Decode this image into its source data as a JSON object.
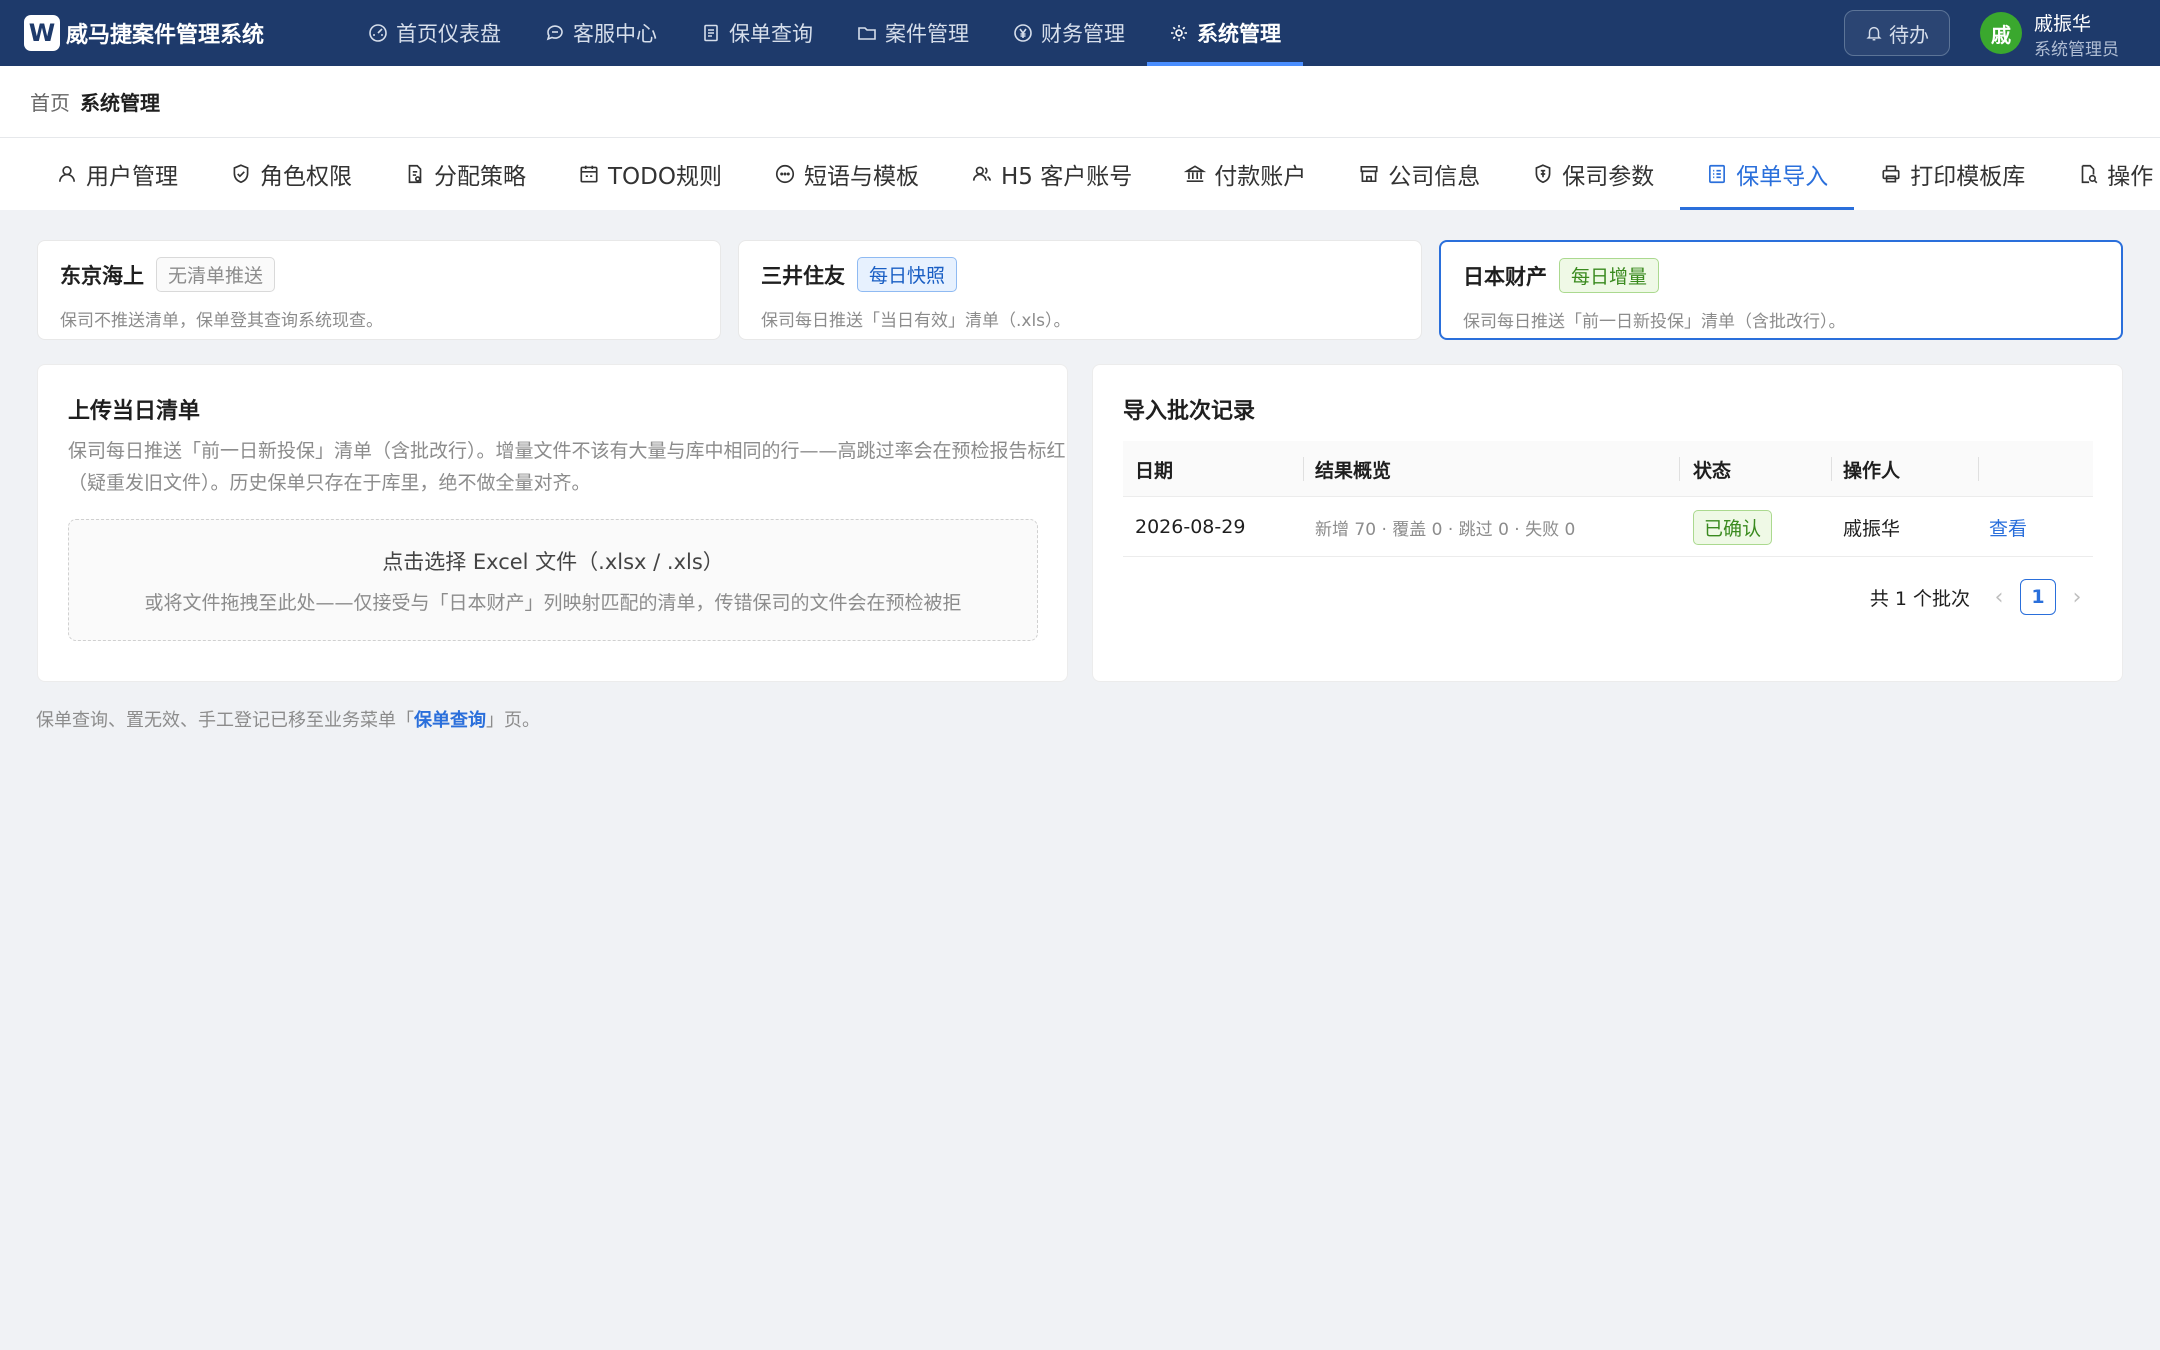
{
  "app": {
    "logo_letter": "W",
    "title": "威马捷案件管理系统"
  },
  "nav": {
    "items": [
      {
        "label": "首页仪表盘",
        "icon": "dashboard-icon"
      },
      {
        "label": "客服中心",
        "icon": "chat-icon"
      },
      {
        "label": "保单查询",
        "icon": "document-icon"
      },
      {
        "label": "案件管理",
        "icon": "folder-icon"
      },
      {
        "label": "财务管理",
        "icon": "yen-icon"
      },
      {
        "label": "系统管理",
        "icon": "gear-icon"
      }
    ],
    "active_index": 5
  },
  "header": {
    "todo_label": "待办",
    "user": {
      "avatar_text": "戚",
      "name": "戚振华",
      "role": "系统管理员",
      "avatar_color": "#3aa82e"
    }
  },
  "breadcrumb": {
    "home": "首页",
    "current": "系统管理"
  },
  "tabs": {
    "items": [
      {
        "label": "用户管理",
        "icon": "user-icon"
      },
      {
        "label": "角色权限",
        "icon": "shield-check-icon"
      },
      {
        "label": "分配策略",
        "icon": "doc-gear-icon"
      },
      {
        "label": "TODO规则",
        "icon": "calendar-icon"
      },
      {
        "label": "短语与模板",
        "icon": "message-icon"
      },
      {
        "label": "H5 客户账号",
        "icon": "users-icon"
      },
      {
        "label": "付款账户",
        "icon": "bank-icon"
      },
      {
        "label": "公司信息",
        "icon": "shop-icon"
      },
      {
        "label": "保司参数",
        "icon": "shield-param-icon"
      },
      {
        "label": "保单导入",
        "icon": "list-icon"
      },
      {
        "label": "打印模板库",
        "icon": "printer-icon"
      },
      {
        "label": "操作",
        "icon": "audit-icon"
      }
    ],
    "active_index": 9
  },
  "insurers": [
    {
      "name": "东京海上",
      "tag": "无清单推送",
      "tag_style": "gray",
      "desc": "保司不推送清单，保单登其查询系统现查。",
      "selected": false
    },
    {
      "name": "三井住友",
      "tag": "每日快照",
      "tag_style": "blue",
      "desc": "保司每日推送「当日有效」清单（.xls）。",
      "selected": false
    },
    {
      "name": "日本财产",
      "tag": "每日增量",
      "tag_style": "green",
      "desc": "保司每日推送「前一日新投保」清单（含批改行）。",
      "selected": true
    }
  ],
  "upload": {
    "title": "上传当日清单",
    "desc": "保司每日推送「前一日新投保」清单（含批改行）。增量文件不该有大量与库中相同的行——高跳过率会在预检报告标红（疑重发旧文件）。历史保单只存在于库里，绝不做全量对齐。",
    "dropzone_main": "点击选择 Excel 文件（.xlsx / .xls）",
    "dropzone_sub": "或将文件拖拽至此处——仅接受与「日本财产」列映射匹配的清单，传错保司的文件会在预检被拒"
  },
  "batches": {
    "title": "导入批次记录",
    "columns": [
      "日期",
      "结果概览",
      "状态",
      "操作人",
      ""
    ],
    "rows": [
      {
        "date": "2026-08-29",
        "summary": "新增 70 · 覆盖 0 · 跳过 0 · 失败 0",
        "status": "已确认",
        "operator": "戚振华",
        "action": "查看"
      }
    ],
    "total_text": "共 1 个批次",
    "current_page": "1",
    "prev_symbol": "‹",
    "next_symbol": "›"
  },
  "footer": {
    "prefix": "保单查询、置无效、手工登记已移至业务菜单「",
    "link": "保单查询",
    "suffix": "」页。"
  },
  "colors": {
    "nav_bg": "#1e3a6b",
    "accent": "#2a6fdb",
    "success": "#3a8a1f"
  }
}
